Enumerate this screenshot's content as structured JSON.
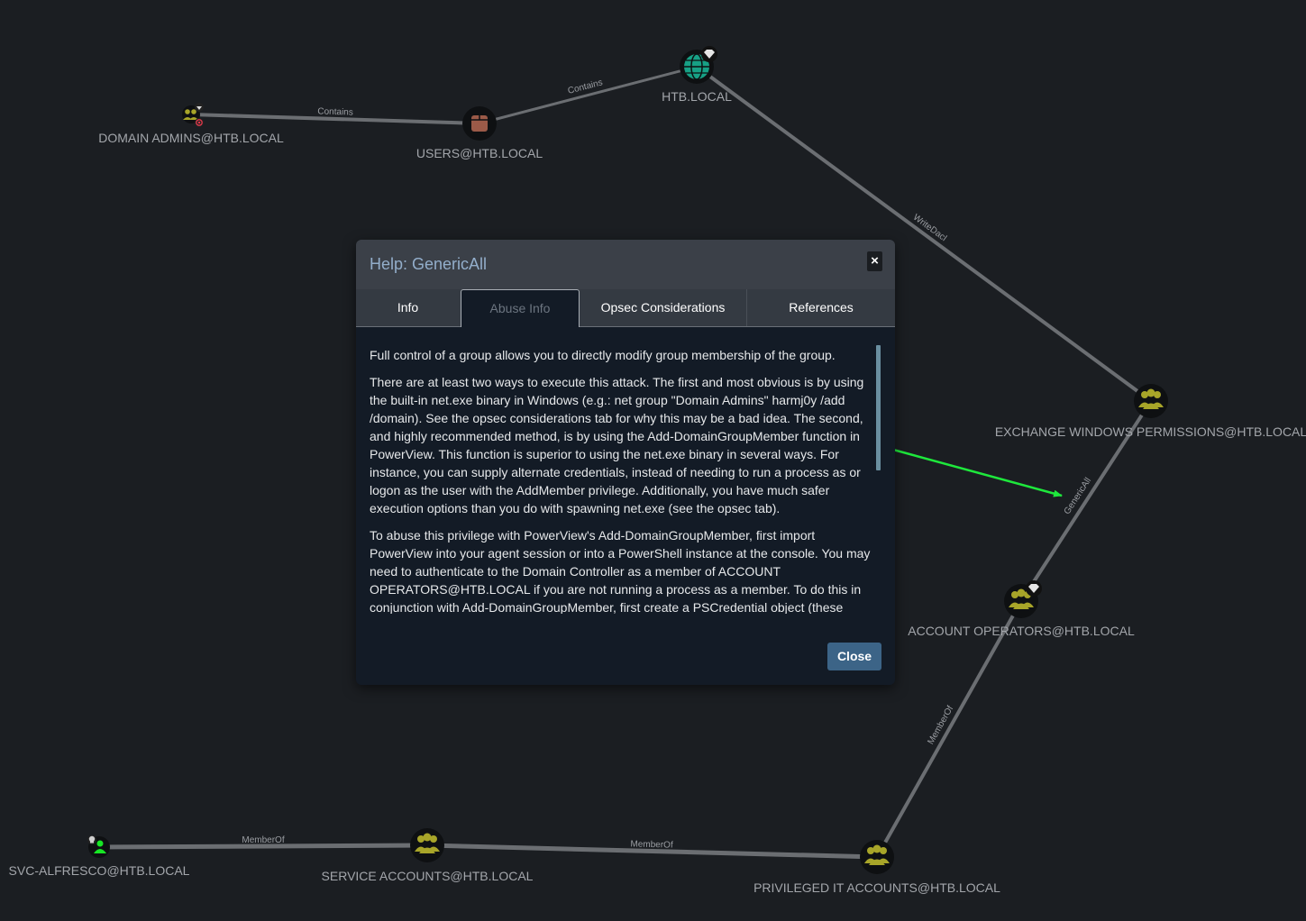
{
  "graph": {
    "nodes": {
      "domain_admins": "DOMAIN ADMINS@HTB.LOCAL",
      "users": "USERS@HTB.LOCAL",
      "htb_local": "HTB.LOCAL",
      "exchange_windows_permissions": "EXCHANGE WINDOWS PERMISSIONS@HTB.LOCAL",
      "account_operators": "ACCOUNT OPERATORS@HTB.LOCAL",
      "svc_alfresco": "SVC-ALFRESCO@HTB.LOCAL",
      "service_accounts": "SERVICE ACCOUNTS@HTB.LOCAL",
      "privileged_it_accounts": "PRIVILEGED IT ACCOUNTS@HTB.LOCAL"
    },
    "edges": {
      "contains_1": "Contains",
      "contains_2": "Contains",
      "writedacl": "WriteDacl",
      "genericall": "GenericAll",
      "memberof_1": "MemberOf",
      "memberof_2": "MemberOf",
      "memberof_3": "MemberOf"
    },
    "colors": {
      "group_icon": "#a8a529",
      "user_icon": "#17e625",
      "domain_icon": "#17a085",
      "ou_icon": "#9b5a48",
      "annotation_arrow": "#1ee83c"
    }
  },
  "modal": {
    "title": "Help: GenericAll",
    "close_x": "×",
    "tabs": [
      "Info",
      "Abuse Info",
      "Opsec Considerations",
      "References"
    ],
    "active_tab": "Abuse Info",
    "paragraphs": [
      "Full control of a group allows you to directly modify group membership of the group.",
      "There are at least two ways to execute this attack. The first and most obvious is by using the built-in net.exe binary in Windows (e.g.: net group \"Domain Admins\" harmj0y /add /domain). See the opsec considerations tab for why this may be a bad idea. The second, and highly recommended method, is by using the Add-DomainGroupMember function in PowerView. This function is superior to using the net.exe binary in several ways. For instance, you can supply alternate credentials, instead of needing to run a process as or logon as the user with the AddMember privilege. Additionally, you have much safer execution options than you do with spawning net.exe (see the opsec tab).",
      "To abuse this privilege with PowerView's Add-DomainGroupMember, first import PowerView into your agent session or into a PowerShell instance at the console. You may need to authenticate to the Domain Controller as a member of ACCOUNT OPERATORS@HTB.LOCAL if you are not running a process as a member. To do this in conjunction with Add-DomainGroupMember, first create a PSCredential object (these"
    ],
    "close_button": "Close"
  }
}
